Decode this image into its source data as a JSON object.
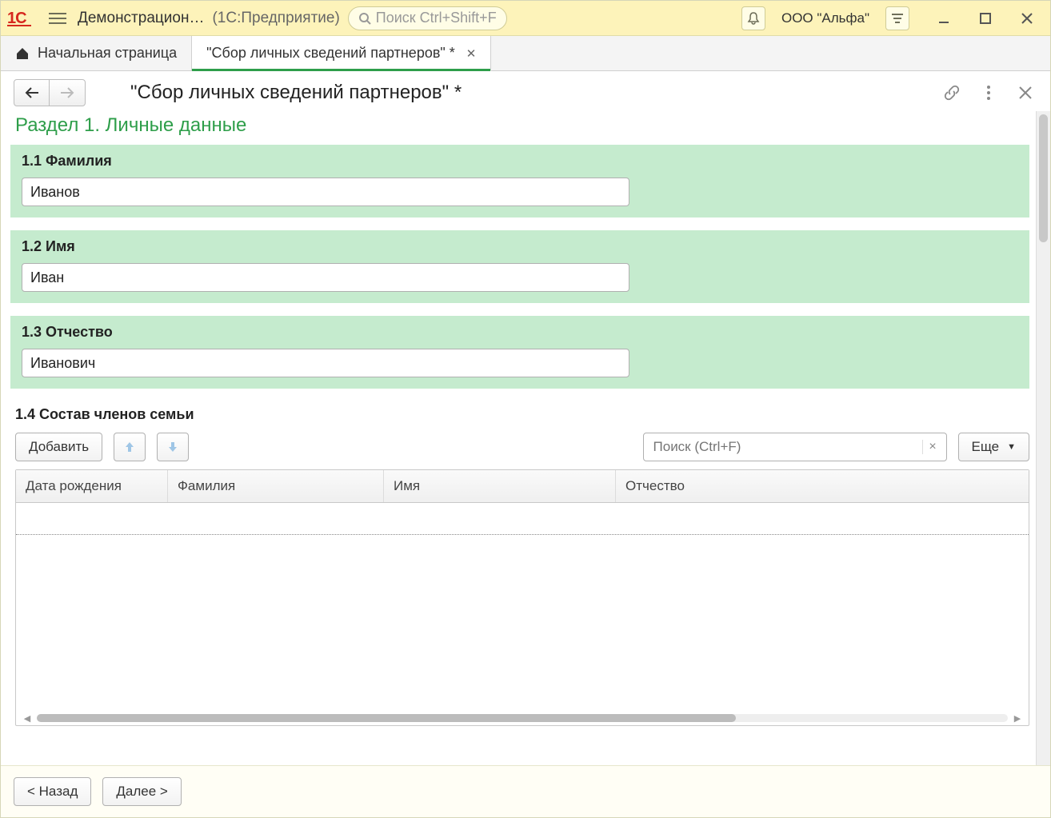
{
  "titlebar": {
    "app_title": "Демонстрацион…",
    "app_subtitle": "(1С:Предприятие)",
    "search_placeholder": "Поиск Ctrl+Shift+F",
    "company_label": "ООО \"Альфа\""
  },
  "tabs": {
    "home_label": "Начальная страница",
    "active_label": "\"Сбор личных сведений партнеров\" *"
  },
  "page": {
    "title": "\"Сбор личных сведений партнеров\" *",
    "section_heading": "Раздел 1. Личные данные"
  },
  "fields": {
    "f11_label": "1.1 Фамилия",
    "f11_value": "Иванов",
    "f12_label": "1.2 Имя",
    "f12_value": "Иван",
    "f13_label": "1.3 Отчество",
    "f13_value": "Иванович",
    "f14_label": "1.4 Состав членов семьи"
  },
  "table_toolbar": {
    "add_label": "Добавить",
    "search_placeholder": "Поиск (Ctrl+F)",
    "more_label": "Еще"
  },
  "table": {
    "col_dob": "Дата рождения",
    "col_fam": "Фамилия",
    "col_name": "Имя",
    "col_patr": "Отчество"
  },
  "footer": {
    "back_label": "< Назад",
    "next_label": "Далее >"
  }
}
